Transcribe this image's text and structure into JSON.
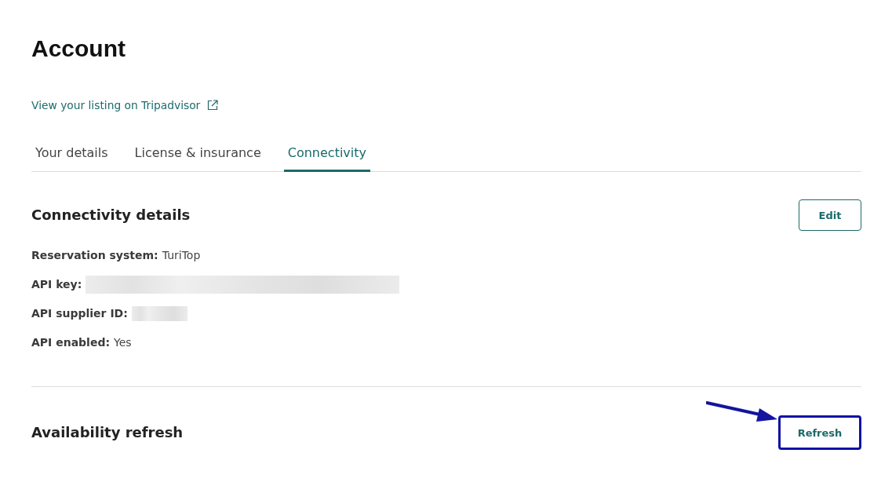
{
  "page": {
    "title": "Account"
  },
  "listing_link": {
    "label": "View your listing on Tripadvisor",
    "external": true
  },
  "tabs": [
    {
      "label": "Your details",
      "selected": false
    },
    {
      "label": "License & insurance",
      "selected": false
    },
    {
      "label": "Connectivity",
      "selected": true
    }
  ],
  "connectivity": {
    "title": "Connectivity details",
    "edit_button": "Edit",
    "fields": [
      {
        "label": "Reservation system:",
        "kind": "text",
        "value": "TuriTop"
      },
      {
        "label": "API key:",
        "kind": "longblur"
      },
      {
        "label": "API supplier ID:",
        "kind": "shortblur"
      },
      {
        "label": "API enabled:",
        "kind": "text",
        "value": "Yes"
      }
    ]
  },
  "availability": {
    "title": "Availability refresh",
    "refresh_button": {
      "label": "Refresh",
      "highlighted": true
    }
  }
}
